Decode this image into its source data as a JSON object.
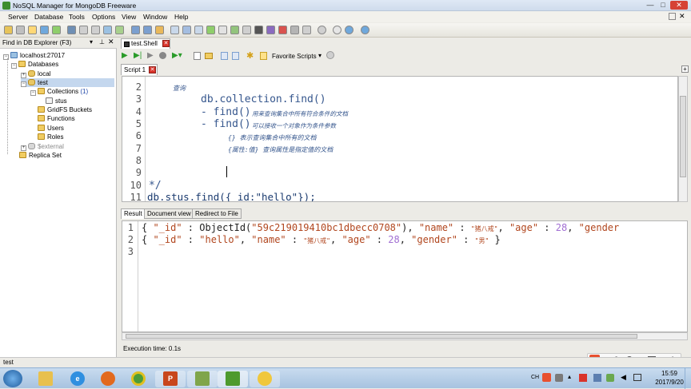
{
  "window": {
    "title": "NoSQL Manager for MongoDB Freeware"
  },
  "menu": [
    "Server",
    "Database",
    "Tools",
    "Options",
    "View",
    "Window",
    "Help"
  ],
  "explorer": {
    "find_label": "Find in DB Explorer (F3)",
    "tree": {
      "server": "localhost:27017",
      "databases": "Databases",
      "local": "local",
      "test": "test",
      "collections": "Collections",
      "collections_count": "(1)",
      "stus": "stus",
      "gridfs": "GridFS Buckets",
      "functions": "Functions",
      "users": "Users",
      "roles": "Roles",
      "external": "$external",
      "replica": "Replica Set"
    }
  },
  "doc_tab": {
    "label": "test.Shell"
  },
  "shell_toolbar": {
    "favorite_scripts": "Favorite Scripts"
  },
  "script_tab": {
    "label": "Script 1"
  },
  "editor": {
    "lines": [
      {
        "num": "2",
        "text": "查询"
      },
      {
        "num": "3",
        "text": "db.collection.find()"
      },
      {
        "num": "4",
        "text": "- find()",
        "note": "用来查询集合中所有符合条件的文档"
      },
      {
        "num": "5",
        "text": "- find()",
        "note": "可以接收一个对象作为条件参数"
      },
      {
        "num": "6",
        "text": "{} 表示查询集合中所有的文档"
      },
      {
        "num": "7",
        "text": "{属性:值} 查询属性是指定值的文档"
      },
      {
        "num": "8",
        "text": ""
      },
      {
        "num": "9",
        "text": ""
      },
      {
        "num": "10",
        "text": "*/"
      },
      {
        "num": "11",
        "text": "db.stus.find({_id:\"hello\"});"
      }
    ]
  },
  "result_tabs": [
    "Result",
    "Document view",
    "Redirect to File"
  ],
  "results": {
    "lines": [
      {
        "num": "1",
        "p1": "{ ",
        "k1": "\"_id\"",
        "p2": " : ObjectId(",
        "v1": "\"59c219019410bc1dbecc0708\"",
        "p3": "), ",
        "k2": "\"name\"",
        "p4": " : ",
        "v2": "\"猪八戒\"",
        "p5": ", ",
        "k3": "\"age\"",
        "p6": " : ",
        "n1": "28",
        "p7": ", ",
        "k4": "\"gender"
      },
      {
        "num": "2",
        "p1": "{ ",
        "k1": "\"_id\"",
        "p2": " : ",
        "v1": "\"hello\"",
        "p3": ", ",
        "k2": "\"name\"",
        "p4": " : ",
        "v2": "\"猪八戒\"",
        "p5": ", ",
        "k3": "\"age\"",
        "p6": " : ",
        "n1": "28",
        "p7": ", ",
        "k4": "\"gender\"",
        "p8": " : ",
        "v3": "\"男\"",
        "p9": " }"
      },
      {
        "num": "3"
      }
    ]
  },
  "exec": {
    "time": "Execution time: 0.1s"
  },
  "status": {
    "db": "test"
  },
  "ime": {
    "lang": "英"
  },
  "clock": {
    "time": "15:59",
    "date": "2017/9/20"
  },
  "tray": {
    "lang": "CH"
  },
  "colors": {
    "accent": "#35568d",
    "string": "#b1461e",
    "number": "#a16fd3"
  }
}
